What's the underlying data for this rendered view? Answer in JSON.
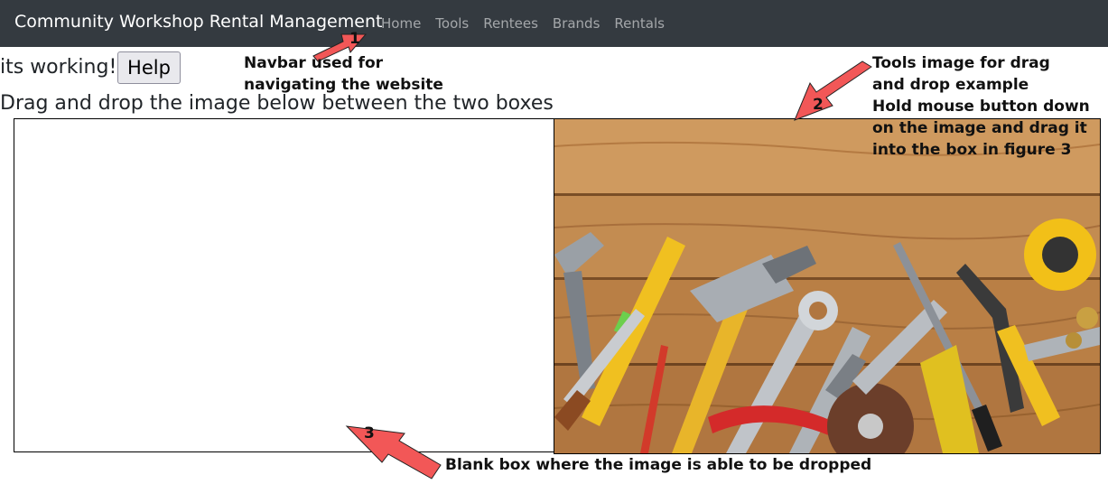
{
  "navbar": {
    "brand": "Community Workshop Rental Management",
    "links": [
      "Home",
      "Tools",
      "Rentees",
      "Brands",
      "Rentals"
    ]
  },
  "status_text": "its working!",
  "help_button": "Help",
  "instructions": "Drag and drop the image below between the two boxes",
  "annotations": {
    "a1": {
      "number": "1",
      "lines": [
        "Navbar used for",
        "navigating the website"
      ]
    },
    "a2": {
      "number": "2",
      "lines": [
        "Tools image for drag",
        "and drop example",
        "Hold mouse button down",
        "on the image and drag it",
        "into the box in figure 3"
      ]
    },
    "a3": {
      "number": "3",
      "lines": [
        "Blank box where the image is able to be dropped"
      ]
    }
  },
  "colors": {
    "navbar_bg": "#343a40",
    "annotation_arrow": "#f25757",
    "wood": "#c48a4e"
  },
  "image_box": {
    "icon": "tools-photo"
  }
}
